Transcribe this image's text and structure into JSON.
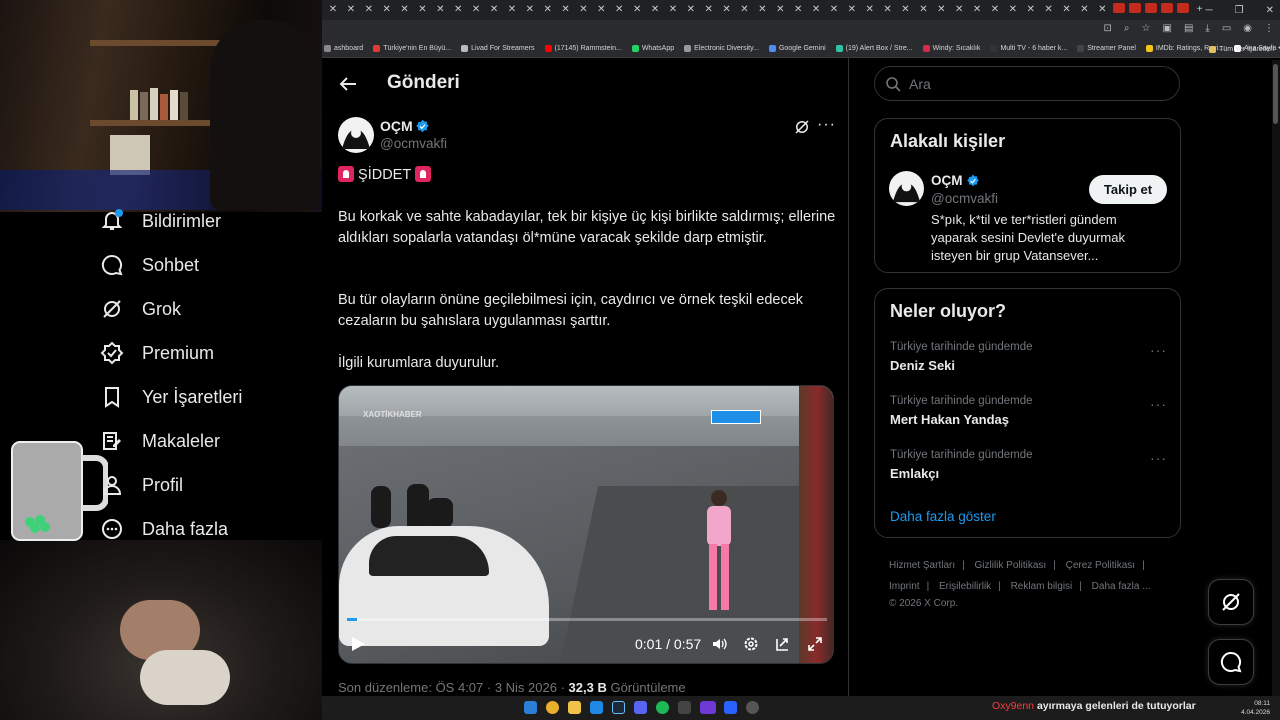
{
  "left_nav": {
    "items": [
      {
        "label": "Bildirimler",
        "icon": "bell-icon"
      },
      {
        "label": "Sohbet",
        "icon": "chat-icon"
      },
      {
        "label": "Grok",
        "icon": "grok-icon"
      },
      {
        "label": "Premium",
        "icon": "premium-icon"
      },
      {
        "label": "Yer İşaretleri",
        "icon": "bookmark-icon"
      },
      {
        "label": "Makaleler",
        "icon": "articles-icon"
      },
      {
        "label": "Profil",
        "icon": "profile-icon"
      },
      {
        "label": "Daha fazla",
        "icon": "more-circle-icon"
      }
    ]
  },
  "bookmarks": [
    {
      "label": "ashboard",
      "color": "#888888"
    },
    {
      "label": "Türkiye'nin En Büyü...",
      "color": "#e53935"
    },
    {
      "label": "Livad For Streamers",
      "color": "#bbbbbb"
    },
    {
      "label": "(17145) Rammstein...",
      "color": "#ff0000"
    },
    {
      "label": "WhatsApp",
      "color": "#25d366"
    },
    {
      "label": "Electronic Diversity...",
      "color": "#999999"
    },
    {
      "label": "Google Gemini",
      "color": "#4f8df5"
    },
    {
      "label": "(19) Alert Box / Stre...",
      "color": "#31c3a2"
    },
    {
      "label": "Windy: Sıcaklık",
      "color": "#d42b4d"
    },
    {
      "label": "Multi TV - 6 haber k...",
      "color": "#333333"
    },
    {
      "label": "Streamer Panel",
      "color": "#444444"
    },
    {
      "label": "IMDb: Ratings, Revi...",
      "color": "#f5c518"
    },
    {
      "label": "Ana Sayfa • HBO Max",
      "color": "#ffffff"
    }
  ],
  "bookmarks_folder": "Tüm Yer İşaretleri",
  "page": {
    "title": "Gönderi"
  },
  "post": {
    "author_name": "OÇM",
    "author_handle": "@ocmvakfi",
    "heading": "ŞİDDET",
    "paragraph1": "Bu korkak ve sahte kabadayılar, tek bir kişiye üç kişi birlikte saldırmış; ellerine aldıkları sopalarla vatandaşı öl*müne varacak şekilde darp etmiştir.",
    "paragraph2": "Bu tür olayların önüne geçilebilmesi için, caydırıcı ve örnek teşkil edecek cezaların bu şahıslara uygulanması şarttır.",
    "paragraph3": "İlgili kurumlara duyurulur.",
    "video": {
      "watermark": "XAOTİKHABER",
      "time": "0:01 / 0:57",
      "progress": 0.02
    },
    "meta": {
      "edited": "Son düzenleme: ÖS 4:07 · 3 Nis 2026 ·",
      "views_count": "32,3 B",
      "views_label": "Görüntüleme"
    }
  },
  "search": {
    "placeholder": "Ara"
  },
  "related": {
    "title": "Alakalı kişiler",
    "name": "OÇM",
    "handle": "@ocmvakfi",
    "follow_label": "Takip et",
    "bio": "S*pık, k*til ve ter*ristleri gündem yaparak sesini Devlet'e duyurmak isteyen bir grup Vatansever..."
  },
  "trends": {
    "title": "Neler oluyor?",
    "items": [
      {
        "category": "Türkiye tarihinde gündemde",
        "name": "Deniz Seki"
      },
      {
        "category": "Türkiye tarihinde gündemde",
        "name": "Mert Hakan Yandaş"
      },
      {
        "category": "Türkiye tarihinde gündemde",
        "name": "Emlakçı"
      }
    ],
    "show_more": "Daha fazla göster"
  },
  "footer": {
    "links": [
      "Hizmet Şartları",
      "Gizlilik Politikası",
      "Çerez Politikası",
      "Imprint",
      "Erişilebilirlik",
      "Reklam bilgisi",
      "Daha fazla ..."
    ],
    "copyright": "© 2026 X Corp."
  },
  "taskbar": {
    "ticker_user": "Oxy9enn",
    "ticker_text": "ayırmaya gelenleri de tutuyorlar",
    "time": "08:11",
    "date": "4.04.2026"
  },
  "colors": {
    "accent": "#1d9bf0",
    "verified": "#1d9bf0",
    "background": "#000000",
    "border": "#2f3336",
    "muted_text": "#71767b"
  }
}
